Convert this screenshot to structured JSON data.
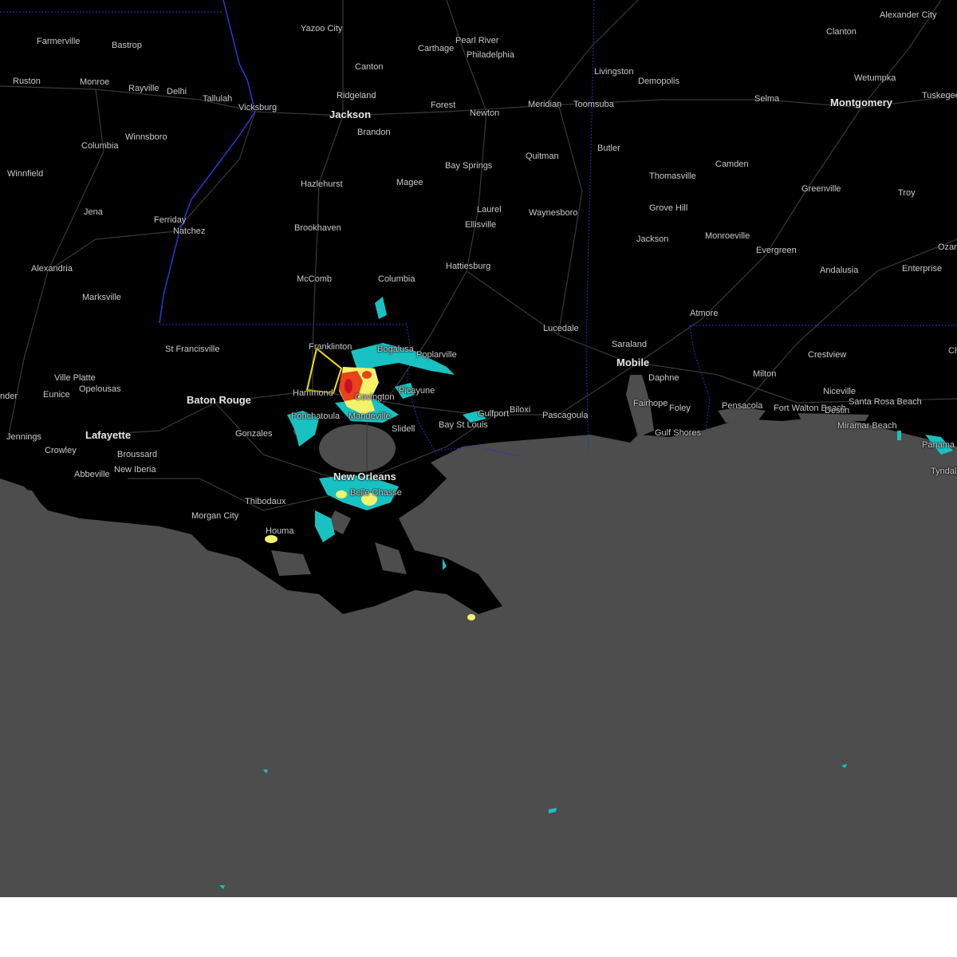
{
  "map": {
    "title": "",
    "colors": {
      "land": "#000000",
      "water": "#4d4d4d",
      "state_border": "#2a3bd6",
      "roads": "#3a3a3a",
      "warning_polygon": "#f5e10a",
      "radar_light": "#19c2c2",
      "radar_moderate": "#f3f36b",
      "radar_heavy": "#e8431a",
      "radar_extreme": "#c8102e"
    },
    "warning_polygon": {
      "type": "severe-thunderstorm-warning-outline",
      "color": "#f5e10a"
    },
    "cities": [
      {
        "name": "Farmerville",
        "size": "small"
      },
      {
        "name": "Bastrop",
        "size": "small"
      },
      {
        "name": "Yazoo City",
        "size": "small"
      },
      {
        "name": "Carthage",
        "size": "small"
      },
      {
        "name": "Pearl River",
        "size": "small"
      },
      {
        "name": "Philadelphia",
        "size": "small"
      },
      {
        "name": "Alexander City",
        "size": "small"
      },
      {
        "name": "Clanton",
        "size": "small"
      },
      {
        "name": "Canton",
        "size": "small"
      },
      {
        "name": "Livingston",
        "size": "small"
      },
      {
        "name": "Ruston",
        "size": "small"
      },
      {
        "name": "Monroe",
        "size": "small"
      },
      {
        "name": "Rayville",
        "size": "small"
      },
      {
        "name": "Delhi",
        "size": "small"
      },
      {
        "name": "Tallulah",
        "size": "small"
      },
      {
        "name": "Vicksburg",
        "size": "small"
      },
      {
        "name": "Ridgeland",
        "size": "small"
      },
      {
        "name": "Jackson",
        "size": "big"
      },
      {
        "name": "Forest",
        "size": "small"
      },
      {
        "name": "Newton",
        "size": "small"
      },
      {
        "name": "Meridian",
        "size": "small"
      },
      {
        "name": "Toomsuba",
        "size": "small"
      },
      {
        "name": "Demopolis",
        "size": "small"
      },
      {
        "name": "Wetumpka",
        "size": "small"
      },
      {
        "name": "Selma",
        "size": "small"
      },
      {
        "name": "Montgomery",
        "size": "big"
      },
      {
        "name": "Tuskegee",
        "size": "small"
      },
      {
        "name": "Brandon",
        "size": "small"
      },
      {
        "name": "Winnsboro",
        "size": "small"
      },
      {
        "name": "Columbia",
        "size": "small"
      },
      {
        "name": "Butler",
        "size": "small"
      },
      {
        "name": "Quitman",
        "size": "small"
      },
      {
        "name": "Bay Springs",
        "size": "small"
      },
      {
        "name": "Camden",
        "size": "small"
      },
      {
        "name": "Thomasville",
        "size": "small"
      },
      {
        "name": "Winnfield",
        "size": "small"
      },
      {
        "name": "Hazlehurst",
        "size": "small"
      },
      {
        "name": "Magee",
        "size": "small"
      },
      {
        "name": "Greenville",
        "size": "small"
      },
      {
        "name": "Troy",
        "size": "small"
      },
      {
        "name": "Grove Hill",
        "size": "small"
      },
      {
        "name": "Jena",
        "size": "small"
      },
      {
        "name": "Laurel",
        "size": "small"
      },
      {
        "name": "Waynesboro",
        "size": "small"
      },
      {
        "name": "Ferriday",
        "size": "small"
      },
      {
        "name": "Ellisville",
        "size": "small"
      },
      {
        "name": "Natchez",
        "size": "small"
      },
      {
        "name": "Brookhaven",
        "size": "small"
      },
      {
        "name": "Monroeville",
        "size": "small"
      },
      {
        "name": "Jackson",
        "size": "small"
      },
      {
        "name": "Evergreen",
        "size": "small"
      },
      {
        "name": "Ozark",
        "size": "small"
      },
      {
        "name": "Hattiesburg",
        "size": "small"
      },
      {
        "name": "Alexandria",
        "size": "small"
      },
      {
        "name": "Andalusia",
        "size": "small"
      },
      {
        "name": "Enterprise",
        "size": "small"
      },
      {
        "name": "McComb",
        "size": "small"
      },
      {
        "name": "Columbia",
        "size": "small"
      },
      {
        "name": "Marksville",
        "size": "small"
      },
      {
        "name": "Atmore",
        "size": "small"
      },
      {
        "name": "Lucedale",
        "size": "small"
      },
      {
        "name": "St Francisville",
        "size": "small"
      },
      {
        "name": "Franklinton",
        "size": "small"
      },
      {
        "name": "Bogalusa",
        "size": "small"
      },
      {
        "name": "Saraland",
        "size": "small"
      },
      {
        "name": "Poplarville",
        "size": "small"
      },
      {
        "name": "Crestview",
        "size": "small"
      },
      {
        "name": "Mobile",
        "size": "big"
      },
      {
        "name": "Ville Platte",
        "size": "small"
      },
      {
        "name": "Milton",
        "size": "small"
      },
      {
        "name": "Daphne",
        "size": "small"
      },
      {
        "name": "Opelousas",
        "size": "small"
      },
      {
        "name": "Picayune",
        "size": "small"
      },
      {
        "name": "Niceville",
        "size": "small"
      },
      {
        "name": "Eunice",
        "size": "small"
      },
      {
        "name": "Baton Rouge",
        "size": "big"
      },
      {
        "name": "Hammond",
        "size": "small"
      },
      {
        "name": "Covington",
        "size": "small"
      },
      {
        "name": "Fairhope",
        "size": "small"
      },
      {
        "name": "Foley",
        "size": "small"
      },
      {
        "name": "Pensacola",
        "size": "small"
      },
      {
        "name": "Santa Rosa Beach",
        "size": "small"
      },
      {
        "name": "Fort Walton Beach",
        "size": "small"
      },
      {
        "name": "Destin",
        "size": "small"
      },
      {
        "name": "Ponchatoula",
        "size": "small"
      },
      {
        "name": "Mandeville",
        "size": "small"
      },
      {
        "name": "Gulfport",
        "size": "small"
      },
      {
        "name": "Biloxi",
        "size": "small"
      },
      {
        "name": "Pascagoula",
        "size": "small"
      },
      {
        "name": "Bay St Louis",
        "size": "small"
      },
      {
        "name": "Miramar Beach",
        "size": "small"
      },
      {
        "name": "Slidell",
        "size": "small"
      },
      {
        "name": "Gulf Shores",
        "size": "small"
      },
      {
        "name": "Jennings",
        "size": "small"
      },
      {
        "name": "Lafayette",
        "size": "big"
      },
      {
        "name": "Gonzales",
        "size": "small"
      },
      {
        "name": "Panama",
        "size": "small"
      },
      {
        "name": "Crowley",
        "size": "small"
      },
      {
        "name": "Broussard",
        "size": "small"
      },
      {
        "name": "New Orleans",
        "size": "big"
      },
      {
        "name": "Abbeville",
        "size": "small"
      },
      {
        "name": "New Iberia",
        "size": "small"
      },
      {
        "name": "Belle Chasse",
        "size": "small"
      },
      {
        "name": "Tyndall",
        "size": "small"
      },
      {
        "name": "Thibodaux",
        "size": "small"
      },
      {
        "name": "Morgan City",
        "size": "small"
      },
      {
        "name": "Houma",
        "size": "small"
      },
      {
        "name": "Ch",
        "size": "small"
      },
      {
        "name": "nder",
        "size": "small"
      }
    ]
  }
}
